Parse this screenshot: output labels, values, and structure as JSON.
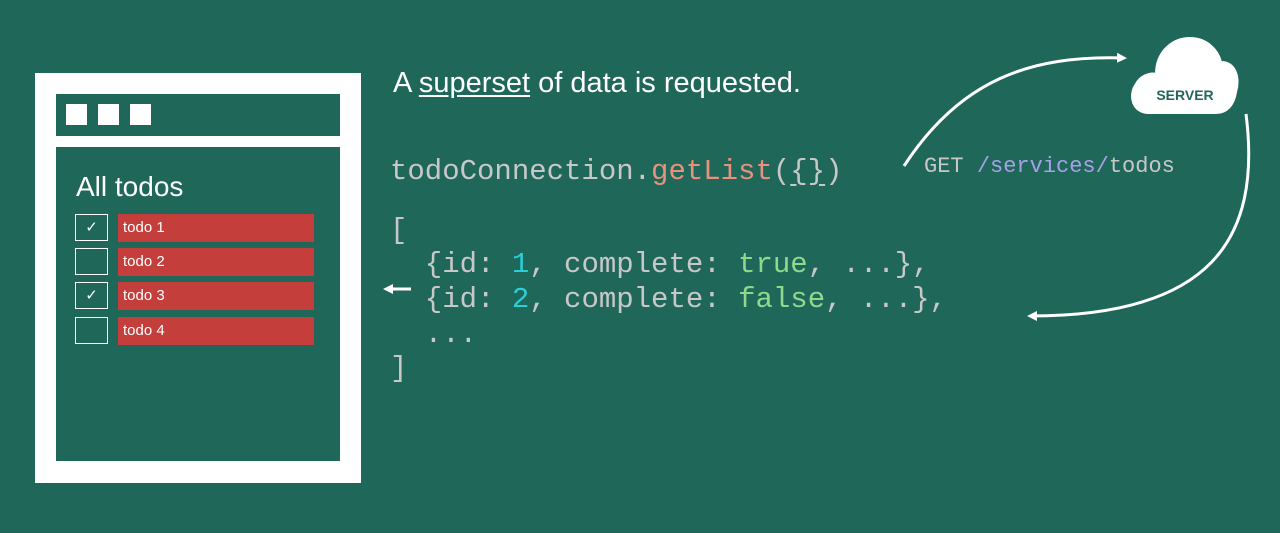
{
  "window": {
    "list_title": "All todos",
    "todos": [
      {
        "label": "todo 1",
        "checked": true,
        "check_glyph": "✓"
      },
      {
        "label": "todo 2",
        "checked": false,
        "check_glyph": ""
      },
      {
        "label": "todo 3",
        "checked": true,
        "check_glyph": "✓"
      },
      {
        "label": "todo 4",
        "checked": false,
        "check_glyph": ""
      }
    ]
  },
  "heading": {
    "prefix": "A ",
    "emphasis": "superset",
    "suffix": " of data is requested."
  },
  "code": {
    "call_object": "todoConnection.",
    "call_method": "getList",
    "call_open": "(",
    "call_arg": "{}",
    "call_close": ")",
    "open_bracket": "[",
    "row1_prefix": "  {id: ",
    "row1_id": "1",
    "row1_mid": ", complete: ",
    "row1_complete": "true",
    "row1_suffix": ", ...},",
    "row2_prefix": "  {id: ",
    "row2_id": "2",
    "row2_mid": ", complete: ",
    "row2_complete": "false",
    "row2_suffix": ", ...},",
    "ellipsis": "  ...",
    "close_bracket": "]"
  },
  "request": {
    "method": "GET ",
    "path": "/services/",
    "resource": "todos"
  },
  "server": {
    "label": "SERVER"
  },
  "colors": {
    "background": "#1f6759",
    "todo_bar": "#c43e3c",
    "method_name": "#e8917d",
    "number": "#2ccfd6",
    "boolean": "#8fd88c",
    "path": "#a8a0e8"
  }
}
